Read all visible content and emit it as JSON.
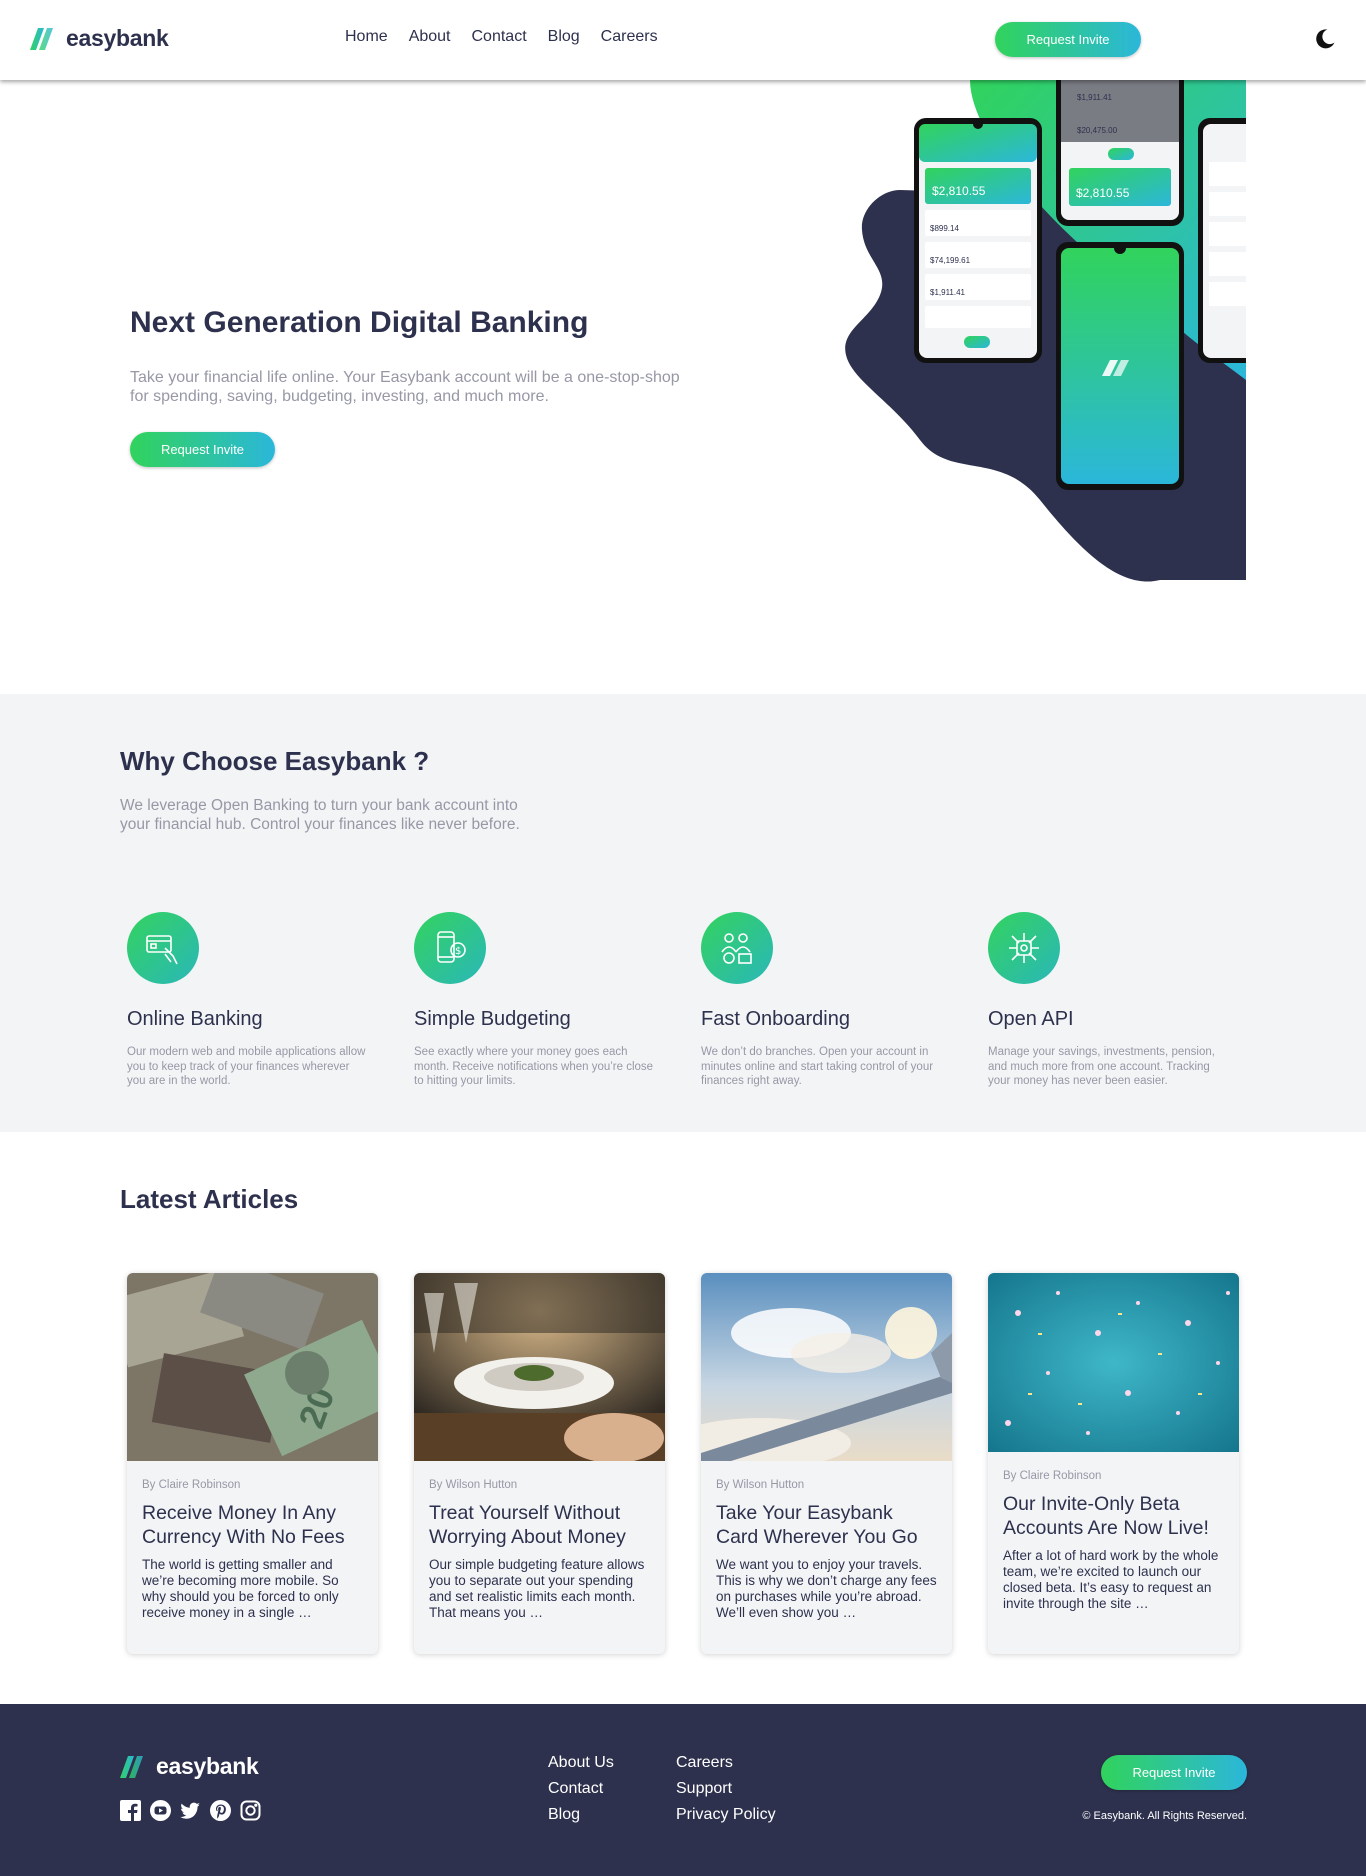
{
  "header": {
    "logo_text": "easybank",
    "nav": [
      "Home",
      "About",
      "Contact",
      "Blog",
      "Careers"
    ],
    "cta_label": "Request Invite",
    "theme_icon": "moon-icon"
  },
  "hero": {
    "title": "Next Generation Digital Banking",
    "text": "Take your financial life online. Your Easybank account will be a one-stop-shop for spending, saving, budgeting, investing, and much more.",
    "cta_label": "Request Invite",
    "phones": {
      "balance": "$2,810.55",
      "rows": [
        "$899.14",
        "$74,199.61",
        "$1,911.41",
        "$20,475.00"
      ],
      "top_rows": [
        "$1,911.41",
        "$20,475.00"
      ]
    }
  },
  "why": {
    "title": "Why Choose Easybank ?",
    "text": "We leverage Open Banking to turn your bank account into your financial hub. Control your finances like never before.",
    "features": [
      {
        "icon": "online-banking-icon",
        "title": "Online Banking",
        "text": "Our modern web and mobile applications allow you to keep track of your finances wherever you are in the world."
      },
      {
        "icon": "budgeting-icon",
        "title": "Simple Budgeting",
        "text": "See exactly where your money goes each month. Receive notifications when you’re close to hitting your limits."
      },
      {
        "icon": "onboarding-icon",
        "title": "Fast Onboarding",
        "text": "We don’t do branches. Open your account in minutes online and start taking control of your finances right away."
      },
      {
        "icon": "api-icon",
        "title": "Open API",
        "text": "Manage your savings, investments, pension, and much more from one account. Tracking your money has never been easier."
      }
    ]
  },
  "articles": {
    "title": "Latest Articles",
    "items": [
      {
        "author": "By Claire Robinson",
        "title": "Receive Money In Any Currency With No Fees",
        "text": "The world is getting smaller and we’re becoming more mobile. So why should you be forced to only receive money in a single …",
        "image": "currency-photo"
      },
      {
        "author": "By Wilson Hutton",
        "title": "Treat Yourself Without Worrying About Money",
        "text": "Our simple budgeting feature allows you to separate out your spending and set realistic limits each month. That means you …",
        "image": "restaurant-photo"
      },
      {
        "author": "By Wilson Hutton",
        "title": "Take Your Easybank Card Wherever You Go",
        "text": "We want you to enjoy your travels. This is why we don’t charge any fees on purchases while you’re abroad. We’ll even show you …",
        "image": "plane-wing-photo"
      },
      {
        "author": "By Claire Robinson",
        "title": "Our Invite-Only Beta Accounts Are Now Live!",
        "text": "After a lot of hard work by the whole team, we’re excited to launch our closed beta. It’s easy to request an invite through the site …",
        "image": "confetti-photo"
      }
    ]
  },
  "footer": {
    "logo_text": "easybank",
    "links_col1": [
      "About Us",
      "Contact",
      "Blog"
    ],
    "links_col2": [
      "Careers",
      "Support",
      "Privacy Policy"
    ],
    "cta_label": "Request Invite",
    "copyright": "© Easybank. All Rights Reserved.",
    "social": [
      "facebook-icon",
      "youtube-icon",
      "twitter-icon",
      "pinterest-icon",
      "instagram-icon"
    ]
  },
  "colors": {
    "dark_blue": "#2d314d",
    "lime_green": "#31d35c",
    "bright_cyan": "#2bb7da",
    "grayish_blue": "#9698a6",
    "light_gray": "#f3f4f6"
  }
}
